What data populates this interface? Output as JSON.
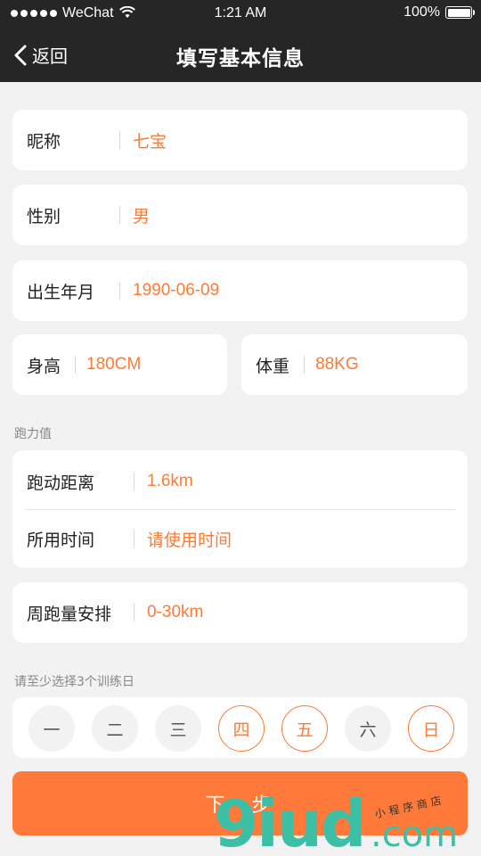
{
  "status_bar": {
    "carrier": "WeChat",
    "time": "1:21 AM",
    "battery": "100%",
    "battery_level": 1.0
  },
  "nav": {
    "back_label": "返回",
    "title": "填写基本信息"
  },
  "basic": {
    "nickname_label": "昵称",
    "nickname_value": "七宝",
    "gender_label": "性别",
    "gender_value": "男",
    "birth_label": "出生年月",
    "birth_value": "1990-06-09",
    "height_label": "身高",
    "height_value": "180CM",
    "weight_label": "体重",
    "weight_value": "88KG"
  },
  "running": {
    "section_label": "跑力值",
    "distance_label": "跑动距离",
    "distance_value": "1.6km",
    "time_label": "所用时间",
    "time_placeholder": "请使用时间",
    "weekly_label": "周跑量安排",
    "weekly_value": "0-30km"
  },
  "training": {
    "hint": "请至少选择3个训练日",
    "days": [
      {
        "label": "一",
        "selected": false
      },
      {
        "label": "二",
        "selected": false
      },
      {
        "label": "三",
        "selected": false
      },
      {
        "label": "四",
        "selected": true
      },
      {
        "label": "五",
        "selected": true
      },
      {
        "label": "六",
        "selected": false
      },
      {
        "label": "日",
        "selected": true
      }
    ]
  },
  "actions": {
    "next_label": "下一步"
  },
  "watermark": {
    "brand": "9iud",
    "domain": ".com",
    "tagline": "小程序商店"
  },
  "colors": {
    "accent": "#ff7a33",
    "header_bg": "#262626",
    "page_bg": "#f2f2f2"
  }
}
